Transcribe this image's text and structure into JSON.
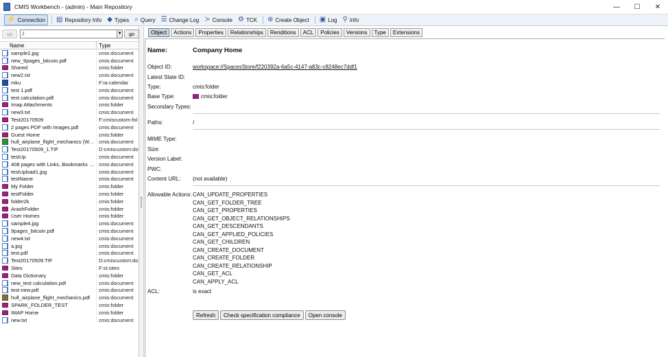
{
  "window": {
    "title": "CMIS Workbench - (admin) - Main Repository",
    "minimize": "—",
    "maximize": "☐",
    "close": "✕"
  },
  "toolbar": {
    "connection": "Connection",
    "repository_info": "Repository Info",
    "types": "Types",
    "query": "Query",
    "change_log": "Change Log",
    "console": "Console",
    "tck": "TCK",
    "create_object": "Create Object",
    "log": "Log",
    "info": "Info"
  },
  "navigation": {
    "up_label": "up",
    "path_value": "/",
    "go_label": "go"
  },
  "file_table": {
    "headers": [
      "Name",
      "Type"
    ],
    "rows": [
      {
        "name": "sample2.jpg",
        "type": "cmis:document",
        "icon": "doc"
      },
      {
        "name": "new_9pages_bitcoin.pdf",
        "type": "cmis:document",
        "icon": "doc"
      },
      {
        "name": "Shared",
        "type": "cmis:folder",
        "icon": "folder"
      },
      {
        "name": "new2.txt",
        "type": "cmis:document",
        "icon": "doc"
      },
      {
        "name": "mku",
        "type": "F:ia:calendar",
        "icon": "cal"
      },
      {
        "name": "test 1.pdf",
        "type": "cmis:document",
        "icon": "doc"
      },
      {
        "name": "test calculation.pdf",
        "type": "cmis:document",
        "icon": "doc"
      },
      {
        "name": "Imap Attachments",
        "type": "cmis:folder",
        "icon": "folder"
      },
      {
        "name": "new3.txt",
        "type": "cmis:document",
        "icon": "doc"
      },
      {
        "name": "Test20170509",
        "type": "F:cmiscustom:fol",
        "icon": "folder"
      },
      {
        "name": "2 pages PDF with Images.pdf",
        "type": "cmis:document",
        "icon": "doc"
      },
      {
        "name": "Guest Home",
        "type": "cmis:folder",
        "icon": "folder"
      },
      {
        "name": "hull_airplane_flight_mechanics (Wor...",
        "type": "cmis:document",
        "icon": "greendoc"
      },
      {
        "name": "Test20170509_1.TIF",
        "type": "D:cmiscustom:do",
        "icon": "doc"
      },
      {
        "name": "testUp",
        "type": "cmis:document",
        "icon": "doc"
      },
      {
        "name": "408 pages with Links, Bookmarks a...",
        "type": "cmis:document",
        "icon": "doc"
      },
      {
        "name": "testUpload1.jpg",
        "type": "cmis:document",
        "icon": "doc"
      },
      {
        "name": "testName",
        "type": "cmis:document",
        "icon": "doc"
      },
      {
        "name": "My Folder",
        "type": "cmis:folder",
        "icon": "folder"
      },
      {
        "name": "testFolder",
        "type": "cmis:folder",
        "icon": "folder"
      },
      {
        "name": "folder2k",
        "type": "cmis:folder",
        "icon": "folder"
      },
      {
        "name": "ArashFolder",
        "type": "cmis:folder",
        "icon": "folder"
      },
      {
        "name": "User Homes",
        "type": "cmis:folder",
        "icon": "folder"
      },
      {
        "name": "sample4.jpg",
        "type": "cmis:document",
        "icon": "doc"
      },
      {
        "name": "9pages_bitcoin.pdf",
        "type": "cmis:document",
        "icon": "doc"
      },
      {
        "name": "new4.txt",
        "type": "cmis:document",
        "icon": "doc"
      },
      {
        "name": "a.jpg",
        "type": "cmis:document",
        "icon": "doc"
      },
      {
        "name": "test.pdf",
        "type": "cmis:document",
        "icon": "doc"
      },
      {
        "name": "Test20170509.TIF",
        "type": "D:cmiscustom:do",
        "icon": "doc"
      },
      {
        "name": "Sites",
        "type": "F:st:sites",
        "icon": "folder"
      },
      {
        "name": "Data Dictionary",
        "type": "cmis:folder",
        "icon": "folder"
      },
      {
        "name": "new_test calculation.pdf",
        "type": "cmis:document",
        "icon": "doc"
      },
      {
        "name": "test-new.pdf",
        "type": "cmis:document",
        "icon": "doc"
      },
      {
        "name": "hull_airplane_flight_mechanics.pdf",
        "type": "cmis:document",
        "icon": "browndoc"
      },
      {
        "name": "SPARK_FOLDER_TEST",
        "type": "cmis:folder",
        "icon": "folder"
      },
      {
        "name": "IMAP Home",
        "type": "cmis:folder",
        "icon": "folder"
      },
      {
        "name": "new.txt",
        "type": "cmis:document",
        "icon": "doc"
      }
    ]
  },
  "tabs": [
    "Object",
    "Actions",
    "Properties",
    "Relationships",
    "Renditions",
    "ACL",
    "Policies",
    "Versions",
    "Type",
    "Extensions"
  ],
  "details": {
    "name_label": "Name:",
    "name_value": "Company Home",
    "object_id_label": "Object ID:",
    "object_id_value": "workspace://SpacesStore/f220392a-6a5c-4147-a83c-c8248ec7ddf1",
    "latest_state_label": "Latest State ID:",
    "type_label": "Type:",
    "type_value": "cmis:folder",
    "base_type_label": "Base Type:",
    "base_type_value": "cmis:folder",
    "secondary_types_label": "Secondary Types:",
    "paths_label": "Paths:",
    "paths_value": "/",
    "mime_label": "MIME Type:",
    "size_label": "Size:",
    "version_label": "Version Label:",
    "pwc_label": "PWC:",
    "content_url_label": "Content URL:",
    "content_url_value": "(not available)",
    "allowable_actions_label": "Allowable Actions:",
    "allowable_actions": [
      "CAN_UPDATE_PROPERTIES",
      "CAN_GET_FOLDER_TREE",
      "CAN_GET_PROPERTIES",
      "CAN_GET_OBJECT_RELATIONSHIPS",
      "CAN_GET_DESCENDANTS",
      "CAN_GET_APPLIED_POLICIES",
      "CAN_GET_CHILDREN",
      "CAN_CREATE_DOCUMENT",
      "CAN_CREATE_FOLDER",
      "CAN_CREATE_RELATIONSHIP",
      "CAN_GET_ACL",
      "CAN_APPLY_ACL"
    ],
    "acl_label": "ACL:",
    "acl_value": "is exact"
  },
  "buttons": {
    "refresh": "Refresh",
    "check_compliance": "Check specification compliance",
    "open_console": "Open console"
  }
}
